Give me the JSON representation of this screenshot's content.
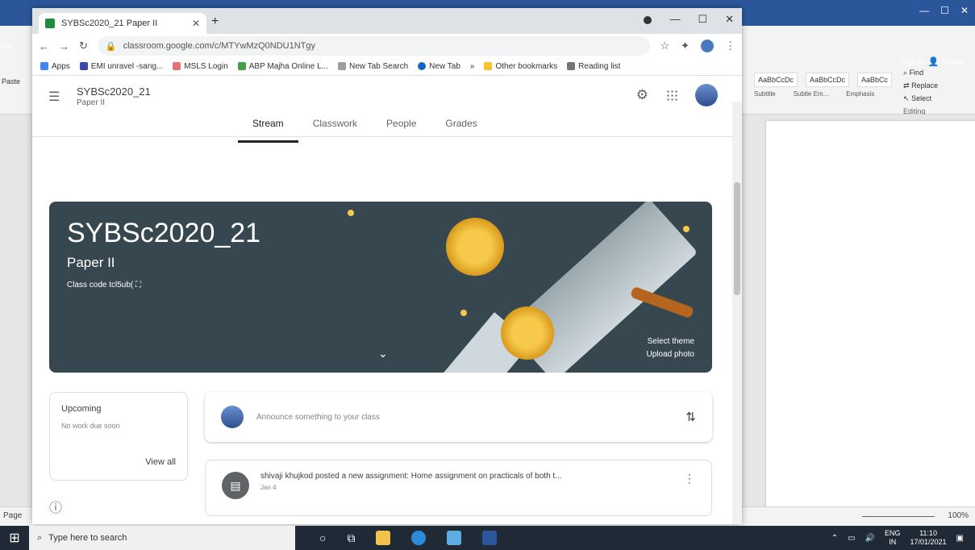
{
  "word": {
    "signin": "Sign in",
    "share": "Share",
    "styles": [
      "AaBbCcDc",
      "AaBbCcDc",
      "AaBbCc"
    ],
    "style_names": [
      "Subtitle",
      "Subtle Em...",
      "Emphasis"
    ],
    "editing": [
      "Find",
      "Replace",
      "Select",
      "Editing"
    ],
    "zoom": "100%",
    "left_tab": "File",
    "left_paste": "Paste",
    "status_left": "Page"
  },
  "chrome": {
    "tab_title": "SYBSc2020_21 Paper II",
    "url": "classroom.google.com/c/MTYwMzQ0NDU1NTgy",
    "bookmarks": [
      "Apps",
      "EMI unravel -sang...",
      "MSLS Login",
      "ABP Majha Online L...",
      "New Tab Search",
      "New Tab",
      "Other bookmarks",
      "Reading list"
    ]
  },
  "classroom": {
    "class_name": "SYBSc2020_21",
    "section": "Paper II",
    "tabs": [
      "Stream",
      "Classwork",
      "People",
      "Grades"
    ],
    "banner_title": "SYBSc2020_21",
    "banner_section": "Paper II",
    "class_code": "Class code tcl5ub( ⛶",
    "select_theme": "Select theme",
    "upload_photo": "Upload photo",
    "upcoming_title": "Upcoming",
    "upcoming_none": "No work due soon",
    "view_all": "View all",
    "announce_placeholder": "Announce something to your class",
    "post_title": "shivaji khujkod posted a new assignment: Home assignment on practicals of both t...",
    "post_date": "Jan 4"
  },
  "taskbar": {
    "search_placeholder": "Type here to search",
    "lang": "ENG",
    "lang2": "IN",
    "time": "11:10",
    "date": "17/01/2021"
  }
}
